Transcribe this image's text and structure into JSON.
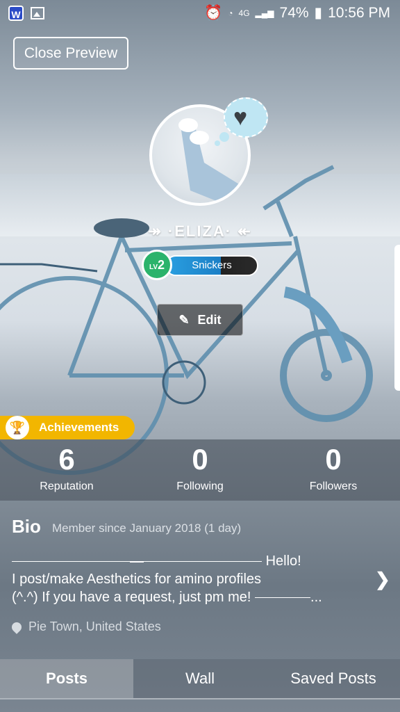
{
  "status_bar": {
    "battery": "74%",
    "time": "10:56 PM",
    "network": "4G"
  },
  "header": {
    "close_preview": "Close Preview"
  },
  "profile": {
    "name": "·ELIZA·",
    "name_left_deco": "↠",
    "name_right_deco": "↞",
    "level_prefix": "LV",
    "level": "2",
    "title_pill": "Snickers",
    "edit_label": "Edit"
  },
  "achievements": {
    "label": "Achievements"
  },
  "stats": [
    {
      "value": "6",
      "label": "Reputation"
    },
    {
      "value": "0",
      "label": "Following"
    },
    {
      "value": "0",
      "label": "Followers"
    }
  ],
  "bio": {
    "heading": "Bio",
    "member_since": "Member since January 2018 (1 day)",
    "hello": "Hello!",
    "line2": "I post/make Aesthetics for amino profiles",
    "line3": "(^.^) If you have a request, just pm me!",
    "ellipsis": "...",
    "location": "Pie Town, United States"
  },
  "tabs": [
    "Posts",
    "Wall",
    "Saved Posts"
  ],
  "icons": {
    "status_left": [
      "app-icon",
      "gallery-icon"
    ],
    "status_right": [
      "alarm-icon",
      "wifi-icon",
      "signal-icon",
      "battery-icon"
    ],
    "heart": "heart-icon",
    "edit": "edit-icon",
    "achievement": "trophy-icon",
    "chevron": "chevron-right-icon",
    "location": "location-pin-icon"
  }
}
